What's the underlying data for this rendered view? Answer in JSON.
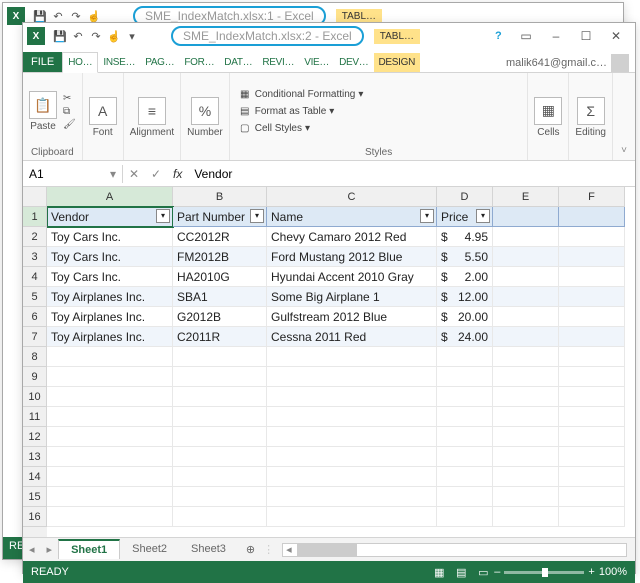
{
  "back_window": {
    "title": "SME_IndexMatch.xlsx:1 - Excel",
    "tab_tools": "TABL…"
  },
  "front_window": {
    "title": "SME_IndexMatch.xlsx:2 - Excel",
    "tab_tools": "TABL…"
  },
  "tabs": {
    "file": "FILE",
    "items": [
      "HO…",
      "INSE…",
      "PAG…",
      "FOR…",
      "DAT…",
      "REVI…",
      "VIE…",
      "DEV…"
    ],
    "design": "DESIGN",
    "user": "malik641@gmail.c…"
  },
  "ribbon": {
    "clipboard": {
      "paste": "Paste",
      "label": "Clipboard"
    },
    "font": {
      "btn": "Font",
      "label": ""
    },
    "align": {
      "btn": "Alignment",
      "label": ""
    },
    "number": {
      "btn": "Number",
      "label": ""
    },
    "styles": {
      "cond": "Conditional Formatting",
      "table": "Format as Table",
      "cell": "Cell Styles",
      "label": "Styles"
    },
    "cells": {
      "btn": "Cells"
    },
    "editing": {
      "btn": "Editing"
    }
  },
  "formula_bar": {
    "ref": "A1",
    "value": "Vendor"
  },
  "columns": [
    "A",
    "B",
    "C",
    "D",
    "E",
    "F"
  ],
  "table": {
    "headers": [
      "Vendor",
      "Part Number",
      "Name",
      "Price"
    ],
    "rows": [
      {
        "vendor": "Toy Cars Inc.",
        "part": "CC2012R",
        "name": "Chevy Camaro 2012 Red",
        "cur": "$",
        "price": "4.95"
      },
      {
        "vendor": "Toy Cars Inc.",
        "part": "FM2012B",
        "name": "Ford Mustang 2012 Blue",
        "cur": "$",
        "price": "5.50"
      },
      {
        "vendor": "Toy Cars Inc.",
        "part": "HA2010G",
        "name": "Hyundai Accent 2010 Gray",
        "cur": "$",
        "price": "2.00"
      },
      {
        "vendor": "Toy Airplanes Inc.",
        "part": "SBA1",
        "name": "Some Big Airplane 1",
        "cur": "$",
        "price": "12.00"
      },
      {
        "vendor": "Toy Airplanes Inc.",
        "part": "G2012B",
        "name": "Gulfstream 2012 Blue",
        "cur": "$",
        "price": "20.00"
      },
      {
        "vendor": "Toy Airplanes Inc.",
        "part": "C2011R",
        "name": "Cessna 2011 Red",
        "cur": "$",
        "price": "24.00"
      }
    ]
  },
  "sheets": {
    "active": "Sheet1",
    "others": [
      "Sheet2",
      "Sheet3"
    ]
  },
  "status": {
    "ready": "READY",
    "zoom": "100%"
  }
}
